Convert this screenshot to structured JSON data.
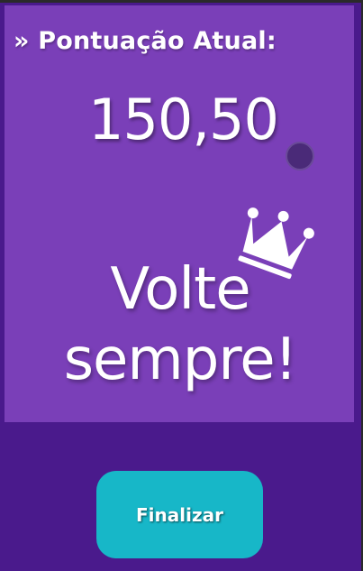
{
  "score": {
    "title": "» Pontuação Atual:",
    "value": "150,50"
  },
  "farewell": {
    "line1": "Volte",
    "line2": "sempre!"
  },
  "actions": {
    "finish_label": "Finalizar"
  },
  "colors": {
    "background": "#4a1a8c",
    "card": "#7a3fb8",
    "button": "#17b7c8",
    "text": "#ffffff"
  },
  "icons": {
    "crown": "crown-icon",
    "dot": "dot-marker"
  }
}
